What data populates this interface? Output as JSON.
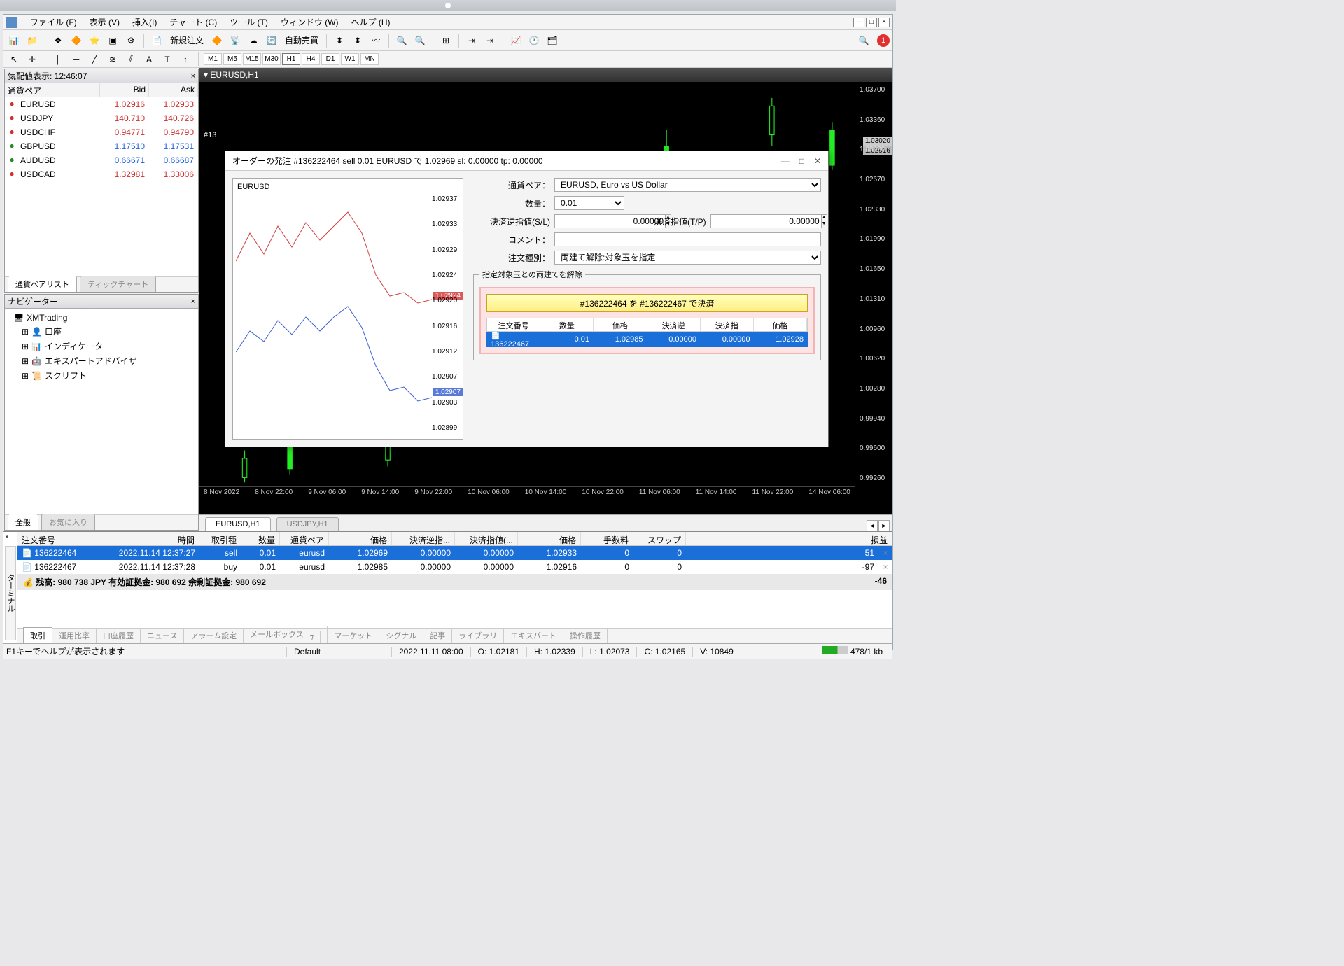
{
  "menu": {
    "file": "ファイル (F)",
    "view": "表示 (V)",
    "insert": "挿入(I)",
    "chart": "チャート (C)",
    "tool": "ツール (T)",
    "window": "ウィンドウ (W)",
    "help": "ヘルプ (H)"
  },
  "toolbar": {
    "neworder": "新規注文",
    "autotrade": "自動売買",
    "noti": "1"
  },
  "timeframes": [
    "M1",
    "M5",
    "M15",
    "M30",
    "H1",
    "H4",
    "D1",
    "W1",
    "MN"
  ],
  "tf_sel": "H1",
  "mw": {
    "title": "気配値表示: 12:46:07",
    "cols": {
      "pair": "通貨ペア",
      "bid": "Bid",
      "ask": "Ask"
    },
    "rows": [
      {
        "dir": "dn",
        "sym": "EURUSD",
        "bid": "1.02916",
        "ask": "1.02933",
        "bc": "dn",
        "ac": "dn"
      },
      {
        "dir": "dn",
        "sym": "USDJPY",
        "bid": "140.710",
        "ask": "140.726",
        "bc": "dn",
        "ac": "dn"
      },
      {
        "dir": "dn",
        "sym": "USDCHF",
        "bid": "0.94771",
        "ask": "0.94790",
        "bc": "dn",
        "ac": "dn"
      },
      {
        "dir": "up",
        "sym": "GBPUSD",
        "bid": "1.17510",
        "ask": "1.17531",
        "bc": "up",
        "ac": "up"
      },
      {
        "dir": "up",
        "sym": "AUDUSD",
        "bid": "0.66671",
        "ask": "0.66687",
        "bc": "up",
        "ac": "up"
      },
      {
        "dir": "dn",
        "sym": "USDCAD",
        "bid": "1.32981",
        "ask": "1.33006",
        "bc": "dn",
        "ac": "dn"
      }
    ],
    "tab1": "通貨ペアリスト",
    "tab2": "ティックチャート"
  },
  "nav": {
    "title": "ナビゲーター",
    "root": "XMTrading",
    "items": [
      "口座",
      "インディケータ",
      "エキスパートアドバイザ",
      "スクリプト"
    ],
    "tab1": "全般",
    "tab2": "お気に入り"
  },
  "chart": {
    "title": "EURUSD,H1",
    "badge_top": "1.03020",
    "badge_px": "1.02916",
    "ylabels": [
      "1.03700",
      "1.03360",
      "1.03020",
      "1.02670",
      "1.02330",
      "1.01990",
      "1.01650",
      "1.01310",
      "1.00960",
      "1.00620",
      "1.00280",
      "0.99940",
      "0.99600",
      "0.99260"
    ],
    "xlabels": [
      "8 Nov 2022",
      "8 Nov 22:00",
      "9 Nov 06:00",
      "9 Nov 14:00",
      "9 Nov 22:00",
      "10 Nov 06:00",
      "10 Nov 14:00",
      "10 Nov 22:00",
      "11 Nov 06:00",
      "11 Nov 14:00",
      "11 Nov 22:00",
      "14 Nov 06:00"
    ],
    "tabs": [
      "EURUSD,H1",
      "USDJPY,H1"
    ],
    "behind": "#13"
  },
  "dialog": {
    "title": "オーダーの発注 #136222464 sell 0.01 EURUSD で 1.02969 sl: 0.00000 tp: 0.00000",
    "chartlabel": "EURUSD",
    "ylabels": [
      "1.02937",
      "1.02933",
      "1.02929",
      "1.02924",
      "1.02920",
      "1.02916",
      "1.02912",
      "1.02907",
      "1.02903",
      "1.02899"
    ],
    "badge_r": "1.02924",
    "badge_b": "1.02907",
    "f": {
      "pair_l": "通貨ペア：",
      "pair_v": "EURUSD, Euro vs US Dollar",
      "vol_l": "数量：",
      "vol_v": "0.01",
      "sl_l": "決済逆指値(S/L)",
      "sl_v": "0.00000",
      "tp_l": "決済指値(T/P)",
      "tp_v": "0.00000",
      "cmt_l": "コメント：",
      "type_l": "注文種別：",
      "type_v": "両建て解除:対象玉を指定",
      "legend": "指定対象玉との両建てを解除",
      "btn": "#136222464 を #136222467 で決済",
      "th": [
        "注文番号",
        "数量",
        "価格",
        "決済逆",
        "決済指",
        "価格"
      ],
      "tr": [
        "136222467",
        "0.01",
        "1.02985",
        "0.00000",
        "0.00000",
        "1.02928"
      ]
    }
  },
  "term": {
    "label": "ターミナル",
    "cols": [
      "注文番号",
      "時間",
      "取引種別",
      "数量",
      "通貨ペア",
      "価格",
      "決済逆指...",
      "決済指値(...",
      "価格",
      "手数料",
      "スワップ",
      "損益"
    ],
    "rows": [
      {
        "sel": true,
        "v": [
          "136222464",
          "2022.11.14 12:37:27",
          "sell",
          "0.01",
          "eurusd",
          "1.02969",
          "0.00000",
          "0.00000",
          "1.02933",
          "0",
          "0",
          "51"
        ]
      },
      {
        "sel": false,
        "v": [
          "136222467",
          "2022.11.14 12:37:28",
          "buy",
          "0.01",
          "eurusd",
          "1.02985",
          "0.00000",
          "0.00000",
          "1.02916",
          "0",
          "0",
          "-97"
        ]
      }
    ],
    "bal": "残高: 980 738 JPY  有効証拠金: 980 692  余剰証拠金: 980 692",
    "bal_r": "-46",
    "tabs": [
      "取引",
      "運用比率",
      "口座履歴",
      "ニュース",
      "アラーム設定",
      "メールボックス",
      "マーケット",
      "シグナル",
      "記事",
      "ライブラリ",
      "エキスパート",
      "操作履歴"
    ]
  },
  "status": {
    "help": "F1キーでヘルプが表示されます",
    "prof": "Default",
    "dt": "2022.11.11 08:00",
    "o": "O: 1.02181",
    "h": "H: 1.02339",
    "l": "L: 1.02073",
    "c": "C: 1.02165",
    "v": "V: 10849",
    "conn": "478/1 kb"
  }
}
